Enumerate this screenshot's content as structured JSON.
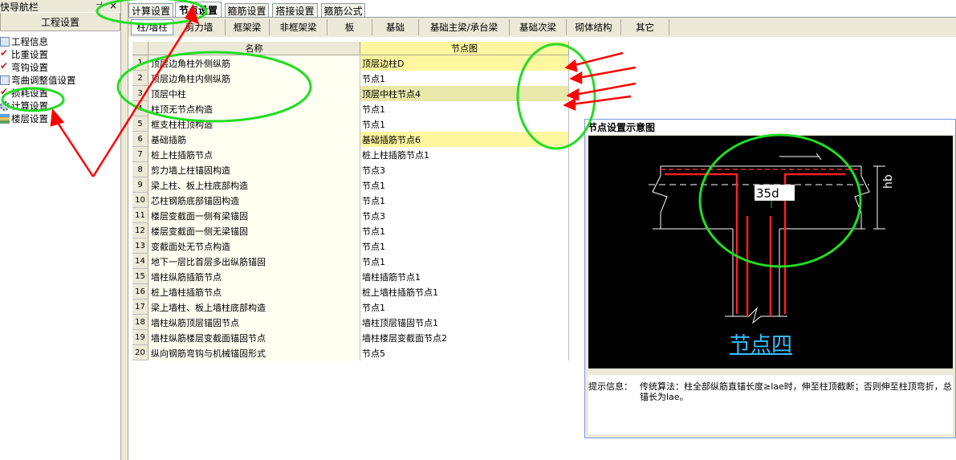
{
  "nav": {
    "title": "快导航栏",
    "pin_icon": "pin-icon",
    "close_glyph": "×",
    "header": "工程设置",
    "items": [
      {
        "label": "工程信息",
        "icon": "document-icon"
      },
      {
        "label": "比重设置",
        "icon": "check-icon"
      },
      {
        "label": "弯钩设置",
        "icon": "check-icon"
      },
      {
        "label": "弯曲调整值设置",
        "icon": "document-icon"
      },
      {
        "label": "损耗设置",
        "icon": "check-icon"
      },
      {
        "label": "计算设置",
        "icon": "gear-icon"
      },
      {
        "label": "楼层设置",
        "icon": "layers-icon"
      }
    ]
  },
  "tabs": [
    {
      "label": "计算设置"
    },
    {
      "label": "节点设置"
    },
    {
      "label": "箍筋设置"
    },
    {
      "label": "搭接设置"
    },
    {
      "label": "箍筋公式"
    }
  ],
  "subtabs": [
    {
      "label": "柱/墙柱"
    },
    {
      "label": "剪力墙"
    },
    {
      "label": "框架梁"
    },
    {
      "label": "非框架梁"
    },
    {
      "label": "板"
    },
    {
      "label": "基础"
    },
    {
      "label": "基础主梁/承台梁"
    },
    {
      "label": "基础次梁"
    },
    {
      "label": "砌体结构"
    },
    {
      "label": "其它"
    }
  ],
  "grid": {
    "headers": {
      "name": "名称",
      "node": "节点图"
    },
    "rows": [
      {
        "num": "1",
        "name": "顶层边角柱外侧纵筋",
        "node": "顶层边柱D"
      },
      {
        "num": "2",
        "name": "顶层边角柱内侧纵筋",
        "node": "节点1"
      },
      {
        "num": "3",
        "name": "顶层中柱",
        "node": "顶层中柱节点4"
      },
      {
        "num": "4",
        "name": "柱顶无节点构造",
        "node": "节点1"
      },
      {
        "num": "5",
        "name": "框支柱柱顶构造",
        "node": "节点1"
      },
      {
        "num": "6",
        "name": "基础插筋",
        "node": "基础插筋节点6"
      },
      {
        "num": "7",
        "name": "桩上柱插筋节点",
        "node": "桩上柱插筋节点1"
      },
      {
        "num": "8",
        "name": "剪力墙上柱锚固构造",
        "node": "节点3"
      },
      {
        "num": "9",
        "name": "梁上柱、板上柱底部构造",
        "node": "节点1"
      },
      {
        "num": "10",
        "name": "芯柱钢筋底部锚固构造",
        "node": "节点1"
      },
      {
        "num": "11",
        "name": "楼层变截面一侧有梁锚固",
        "node": "节点3"
      },
      {
        "num": "12",
        "name": "楼层变截面一侧无梁锚固",
        "node": "节点1"
      },
      {
        "num": "13",
        "name": "变截面处无节点构造",
        "node": "节点1"
      },
      {
        "num": "14",
        "name": "地下一层比首层多出纵筋锚固",
        "node": "节点1"
      },
      {
        "num": "15",
        "name": "墙柱纵筋插筋节点",
        "node": "墙柱插筋节点1"
      },
      {
        "num": "16",
        "name": "桩上墙柱插筋节点",
        "node": "桩上墙柱插筋节点1"
      },
      {
        "num": "17",
        "name": "梁上墙柱、板上墙柱底部构造",
        "node": "节点1"
      },
      {
        "num": "18",
        "name": "墙柱纵筋顶层锚固节点",
        "node": "墙柱顶层锚固节点1"
      },
      {
        "num": "19",
        "name": "墙柱纵筋楼层变截面锚固节点",
        "node": "墙柱楼层变截面节点2"
      },
      {
        "num": "20",
        "name": "纵向钢筋弯钩与机械锚固形式",
        "node": "节点5"
      }
    ]
  },
  "diagram": {
    "title": "节点设置示意图",
    "dim_label": "35d",
    "hb_label": "hb",
    "node_title": "节点四"
  },
  "hint": {
    "label": "提示信息：",
    "text": "传统算法：柱全部纵筋直锚长度≥lae时，伸至柱顶截断；否则伸至柱顶弯折，总锚长为lae。"
  },
  "colors": {
    "annotation_red": "#ff0000",
    "annotation_green": "#22dd22",
    "rebar_red": "#ff2020",
    "highlight_yellow": "#fff6a0"
  }
}
